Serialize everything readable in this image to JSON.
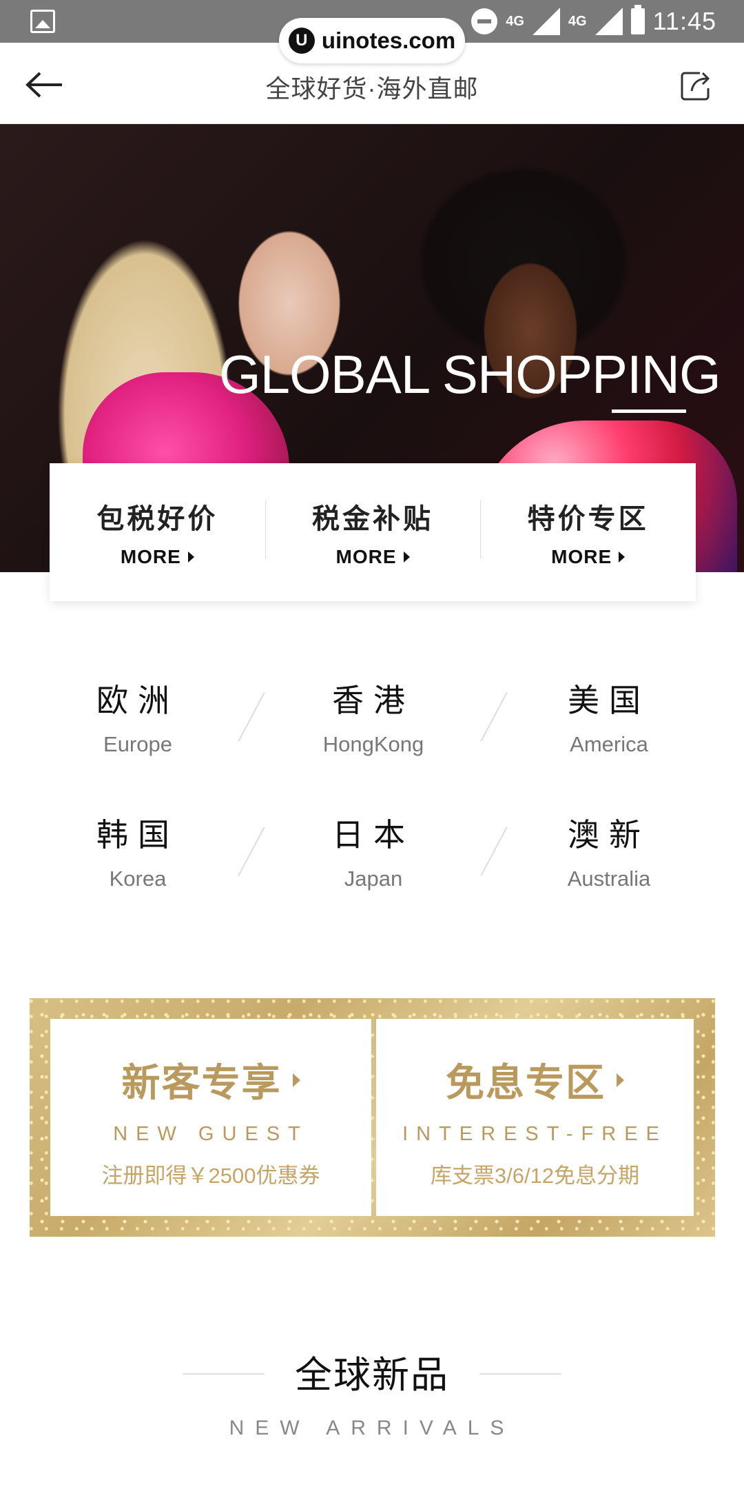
{
  "status_bar": {
    "network_labels": [
      "4G",
      "4G"
    ],
    "time": "11:45"
  },
  "watermark": {
    "logo_letter": "U",
    "text": "uinotes.com"
  },
  "header": {
    "title": "全球好货·海外直邮"
  },
  "hero": {
    "title": "GLOBAL SHOPPING"
  },
  "categories": [
    {
      "title": "包税好价",
      "more": "MORE"
    },
    {
      "title": "税金补贴",
      "more": "MORE"
    },
    {
      "title": "特价专区",
      "more": "MORE"
    }
  ],
  "regions": [
    {
      "zh": "欧洲",
      "en": "Europe"
    },
    {
      "zh": "香港",
      "en": "HongKong"
    },
    {
      "zh": "美国",
      "en": "America"
    },
    {
      "zh": "韩国",
      "en": "Korea"
    },
    {
      "zh": "日本",
      "en": "Japan"
    },
    {
      "zh": "澳新",
      "en": "Australia"
    }
  ],
  "promo": {
    "left": {
      "title": "新客专享",
      "subtitle": "NEW GUEST",
      "desc": "注册即得￥2500优惠券"
    },
    "right": {
      "title": "免息专区",
      "subtitle": "INTEREST-FREE",
      "desc": "库支票3/6/12免息分期"
    }
  },
  "arrivals": {
    "title": "全球新品",
    "subtitle": "NEW ARRIVALS"
  },
  "colors": {
    "gold": "#b99a5c",
    "status_bar": "#7a7a7a"
  }
}
